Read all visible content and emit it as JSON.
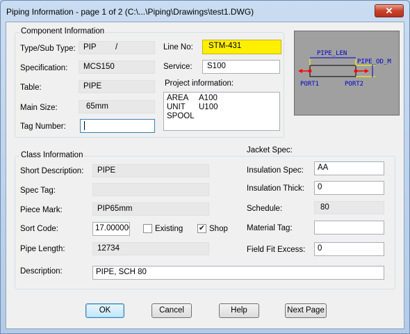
{
  "window": {
    "title": "Piping Information - page 1 of 2 (C:\\...\\Piping\\Drawings\\test1.DWG)",
    "close_label": "✕"
  },
  "component": {
    "title": "Component Information",
    "type_label": "Type/Sub Type:",
    "type_value": "PIP",
    "subtype_value": "/",
    "spec_label": "Specification:",
    "spec_value": "MCS150",
    "table_label": "Table:",
    "table_value": "PIPE",
    "size_label": "Main Size:",
    "size_value": "65mm",
    "tag_label": "Tag Number:",
    "tag_value": "",
    "line_label": "Line No:",
    "line_value": "STM-431",
    "service_label": "Service:",
    "service_value": "S100",
    "project_label": "Project information:",
    "project_lines": [
      {
        "key": "AREA",
        "value": "A100"
      },
      {
        "key": "UNIT",
        "value": "U100"
      },
      {
        "key": "SPOOL",
        "value": ""
      }
    ]
  },
  "preview": {
    "len_label": "PIPE_LEN",
    "od_label": "PIPE_OD_M",
    "port1_label": "PORT1",
    "port2_label": "PORT2",
    "colors": {
      "dim": "#0000cc",
      "port": "#ff0000",
      "guide": "#ffff00"
    }
  },
  "class_info": {
    "title": "Class Information",
    "short_desc_label": "Short Description:",
    "short_desc_value": "PIPE",
    "spec_tag_label": "Spec Tag:",
    "spec_tag_value": "",
    "piece_mark_label": "Piece Mark:",
    "piece_mark_value": "PIP65mm",
    "sort_code_label": "Sort Code:",
    "sort_code_value": "17.000000",
    "existing_label": "Existing",
    "existing_checked": false,
    "shop_label": "Shop",
    "shop_checked": true,
    "pipe_length_label": "Pipe Length:",
    "pipe_length_value": "12734",
    "description_label": "Description:",
    "description_value": "PIPE, SCH 80"
  },
  "jacket": {
    "title": "Jacket Spec:",
    "ins_spec_label": "Insulation Spec:",
    "ins_spec_value": "AA",
    "ins_thick_label": "Insulation Thick:",
    "ins_thick_value": "0",
    "schedule_label": "Schedule:",
    "schedule_value": "80",
    "material_tag_label": "Material Tag:",
    "material_tag_value": "",
    "field_fit_label": "Field Fit Excess:",
    "field_fit_value": "0"
  },
  "buttons": {
    "ok": "OK",
    "cancel": "Cancel",
    "help": "Help",
    "next": "Next Page"
  }
}
